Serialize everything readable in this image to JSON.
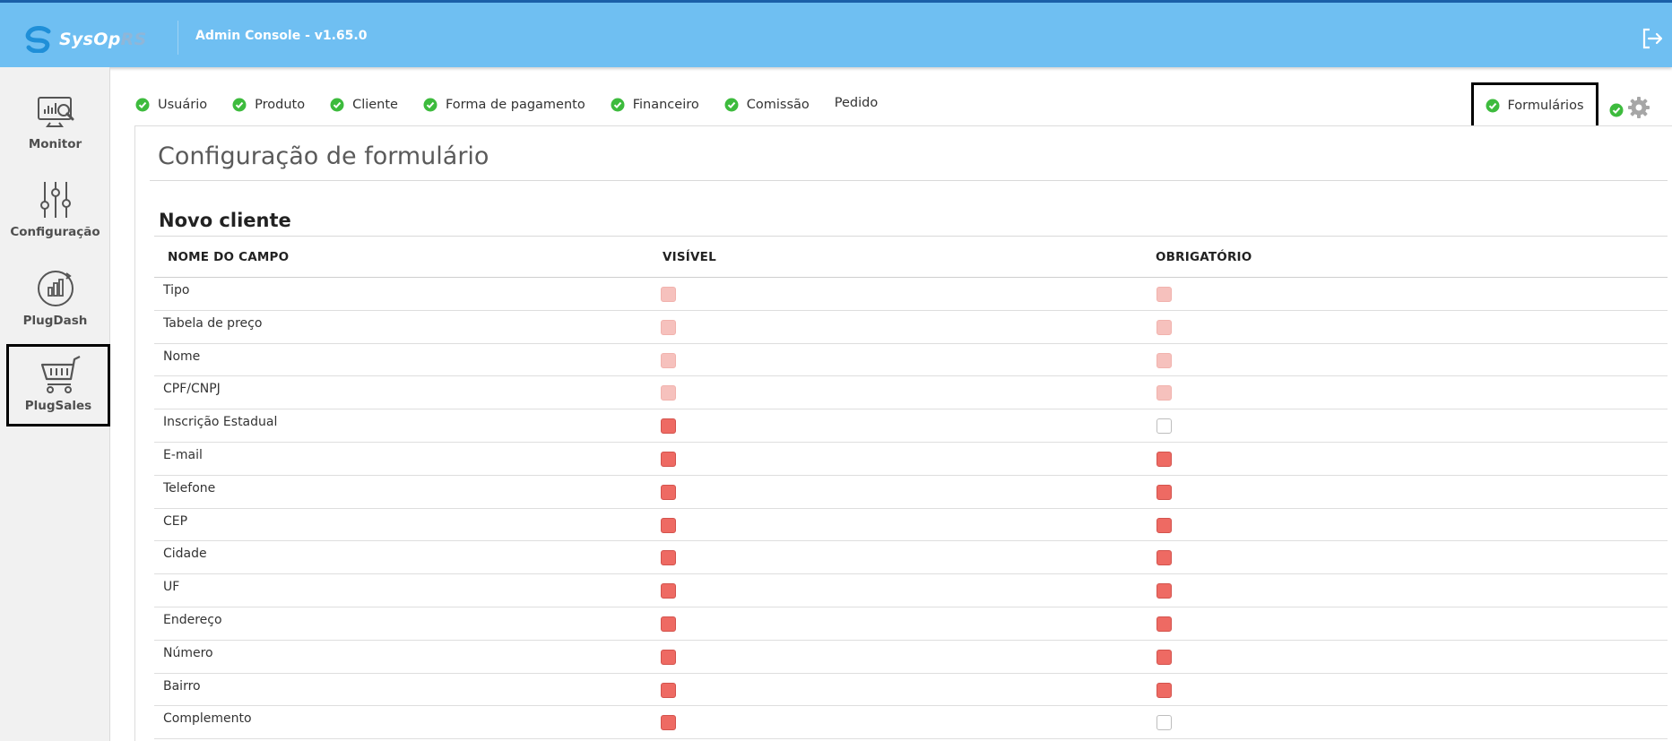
{
  "header": {
    "logo_text_primary": "SysOp",
    "logo_text_secondary": "RS",
    "app_title": "Admin Console - v1.65.0",
    "logout_icon": "logout-icon",
    "colors": {
      "bar": "#6fbff2",
      "bar_border": "#1a5fa8"
    }
  },
  "sidebar": {
    "items": [
      {
        "label": "Monitor",
        "icon": "monitor-chart-icon"
      },
      {
        "label": "Configuração",
        "icon": "sliders-icon"
      },
      {
        "label": "PlugDash",
        "icon": "chart-refresh-icon"
      },
      {
        "label": "PlugSales",
        "icon": "shopping-cart-icon",
        "active": true
      }
    ]
  },
  "tabs": {
    "items": [
      {
        "label": "Usuário",
        "checked": true
      },
      {
        "label": "Produto",
        "checked": true
      },
      {
        "label": "Cliente",
        "checked": true
      },
      {
        "label": "Forma de pagamento",
        "checked": true
      },
      {
        "label": "Financeiro",
        "checked": true
      },
      {
        "label": "Comissão",
        "checked": true
      },
      {
        "label": "Pedido",
        "checked": false
      }
    ],
    "active": {
      "label": "Formulários",
      "checked": true
    },
    "settings_icon": "gear-icon"
  },
  "page": {
    "title": "Configuração de formulário",
    "section_title": "Novo cliente"
  },
  "table": {
    "columns": [
      "NOME DO CAMPO",
      "VISÍVEL",
      "OBRIGATÓRIO"
    ],
    "rows": [
      {
        "field": "Tipo",
        "visible": "disabled-on",
        "required": "disabled-on"
      },
      {
        "field": "Tabela de preço",
        "visible": "disabled-on",
        "required": "disabled-on"
      },
      {
        "field": "Nome",
        "visible": "disabled-on",
        "required": "disabled-on"
      },
      {
        "field": "CPF/CNPJ",
        "visible": "disabled-on",
        "required": "disabled-on"
      },
      {
        "field": "Inscrição Estadual",
        "visible": "on",
        "required": "off"
      },
      {
        "field": "E-mail",
        "visible": "on",
        "required": "on"
      },
      {
        "field": "Telefone",
        "visible": "on",
        "required": "on"
      },
      {
        "field": "CEP",
        "visible": "on",
        "required": "on"
      },
      {
        "field": "Cidade",
        "visible": "on",
        "required": "on"
      },
      {
        "field": "UF",
        "visible": "on",
        "required": "on"
      },
      {
        "field": "Endereço",
        "visible": "on",
        "required": "on"
      },
      {
        "field": "Número",
        "visible": "on",
        "required": "on"
      },
      {
        "field": "Bairro",
        "visible": "on",
        "required": "on"
      },
      {
        "field": "Complemento",
        "visible": "on",
        "required": "off"
      }
    ],
    "colors": {
      "checked": "#ee6a63",
      "checked_disabled": "#f6c1bd",
      "check_ok": "#3dbb3d"
    }
  }
}
